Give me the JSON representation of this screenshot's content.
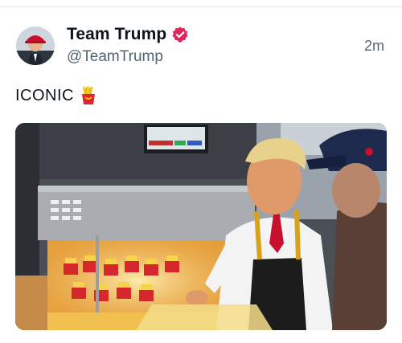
{
  "post": {
    "display_name": "Team Trump",
    "handle": "@TeamTrump",
    "timestamp": "2m",
    "text": "ICONIC",
    "verified_icon": "verified-badge-icon",
    "emoji": "french-fries-icon"
  },
  "colors": {
    "verified_badge": "#e0245e",
    "text_primary": "#0f1419",
    "text_secondary": "#536471",
    "apron": "#1c1c1c",
    "apron_straps": "#d8a21a",
    "tie": "#c8102e"
  },
  "media": {
    "kind": "video-still"
  }
}
